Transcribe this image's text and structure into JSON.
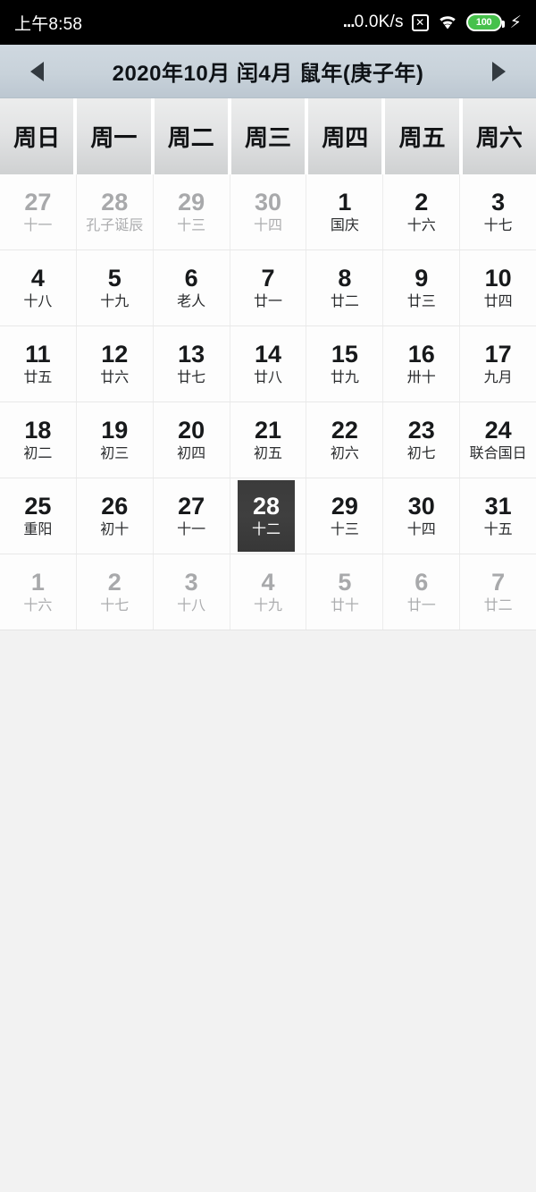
{
  "statusbar": {
    "time": "上午8:58",
    "dots": "...",
    "network_speed": "0.0K/s",
    "nosim_glyph": "✕",
    "battery_level": "100",
    "charging_glyph": "⚡",
    "icons": [
      "no-sim-icon",
      "wifi-icon",
      "battery-icon",
      "charging-bolt-icon"
    ]
  },
  "titlebar": {
    "prev_label": "prev-month",
    "next_label": "next-month",
    "title": "2020年10月 闰4月 鼠年(庚子年)"
  },
  "weekdays": [
    "周日",
    "周一",
    "周二",
    "周三",
    "周四",
    "周五",
    "周六"
  ],
  "colors": {
    "titlebar_bg": "#c8d2da",
    "weekhead_bg": "#e2e3e4",
    "today_bg": "#3b3b3b",
    "page_bg": "#f2f2f2",
    "battery_green": "#46c14b"
  },
  "weeks": [
    [
      {
        "day": "27",
        "lunar": "十一",
        "out": true,
        "today": false
      },
      {
        "day": "28",
        "lunar": "孔子诞辰",
        "out": true,
        "today": false
      },
      {
        "day": "29",
        "lunar": "十三",
        "out": true,
        "today": false
      },
      {
        "day": "30",
        "lunar": "十四",
        "out": true,
        "today": false
      },
      {
        "day": "1",
        "lunar": "国庆",
        "out": false,
        "today": false
      },
      {
        "day": "2",
        "lunar": "十六",
        "out": false,
        "today": false
      },
      {
        "day": "3",
        "lunar": "十七",
        "out": false,
        "today": false
      }
    ],
    [
      {
        "day": "4",
        "lunar": "十八",
        "out": false,
        "today": false
      },
      {
        "day": "5",
        "lunar": "十九",
        "out": false,
        "today": false
      },
      {
        "day": "6",
        "lunar": "老人",
        "out": false,
        "today": false
      },
      {
        "day": "7",
        "lunar": "廿一",
        "out": false,
        "today": false
      },
      {
        "day": "8",
        "lunar": "廿二",
        "out": false,
        "today": false
      },
      {
        "day": "9",
        "lunar": "廿三",
        "out": false,
        "today": false
      },
      {
        "day": "10",
        "lunar": "廿四",
        "out": false,
        "today": false
      }
    ],
    [
      {
        "day": "11",
        "lunar": "廿五",
        "out": false,
        "today": false
      },
      {
        "day": "12",
        "lunar": "廿六",
        "out": false,
        "today": false
      },
      {
        "day": "13",
        "lunar": "廿七",
        "out": false,
        "today": false
      },
      {
        "day": "14",
        "lunar": "廿八",
        "out": false,
        "today": false
      },
      {
        "day": "15",
        "lunar": "廿九",
        "out": false,
        "today": false
      },
      {
        "day": "16",
        "lunar": "卅十",
        "out": false,
        "today": false
      },
      {
        "day": "17",
        "lunar": "九月",
        "out": false,
        "today": false
      }
    ],
    [
      {
        "day": "18",
        "lunar": "初二",
        "out": false,
        "today": false
      },
      {
        "day": "19",
        "lunar": "初三",
        "out": false,
        "today": false
      },
      {
        "day": "20",
        "lunar": "初四",
        "out": false,
        "today": false
      },
      {
        "day": "21",
        "lunar": "初五",
        "out": false,
        "today": false
      },
      {
        "day": "22",
        "lunar": "初六",
        "out": false,
        "today": false
      },
      {
        "day": "23",
        "lunar": "初七",
        "out": false,
        "today": false
      },
      {
        "day": "24",
        "lunar": "联合国日",
        "out": false,
        "today": false
      }
    ],
    [
      {
        "day": "25",
        "lunar": "重阳",
        "out": false,
        "today": false
      },
      {
        "day": "26",
        "lunar": "初十",
        "out": false,
        "today": false
      },
      {
        "day": "27",
        "lunar": "十一",
        "out": false,
        "today": false
      },
      {
        "day": "28",
        "lunar": "十二",
        "out": false,
        "today": true
      },
      {
        "day": "29",
        "lunar": "十三",
        "out": false,
        "today": false
      },
      {
        "day": "30",
        "lunar": "十四",
        "out": false,
        "today": false
      },
      {
        "day": "31",
        "lunar": "十五",
        "out": false,
        "today": false
      }
    ],
    [
      {
        "day": "1",
        "lunar": "十六",
        "out": true,
        "today": false
      },
      {
        "day": "2",
        "lunar": "十七",
        "out": true,
        "today": false
      },
      {
        "day": "3",
        "lunar": "十八",
        "out": true,
        "today": false
      },
      {
        "day": "4",
        "lunar": "十九",
        "out": true,
        "today": false
      },
      {
        "day": "5",
        "lunar": "廿十",
        "out": true,
        "today": false
      },
      {
        "day": "6",
        "lunar": "廿一",
        "out": true,
        "today": false
      },
      {
        "day": "7",
        "lunar": "廿二",
        "out": true,
        "today": false
      }
    ]
  ]
}
